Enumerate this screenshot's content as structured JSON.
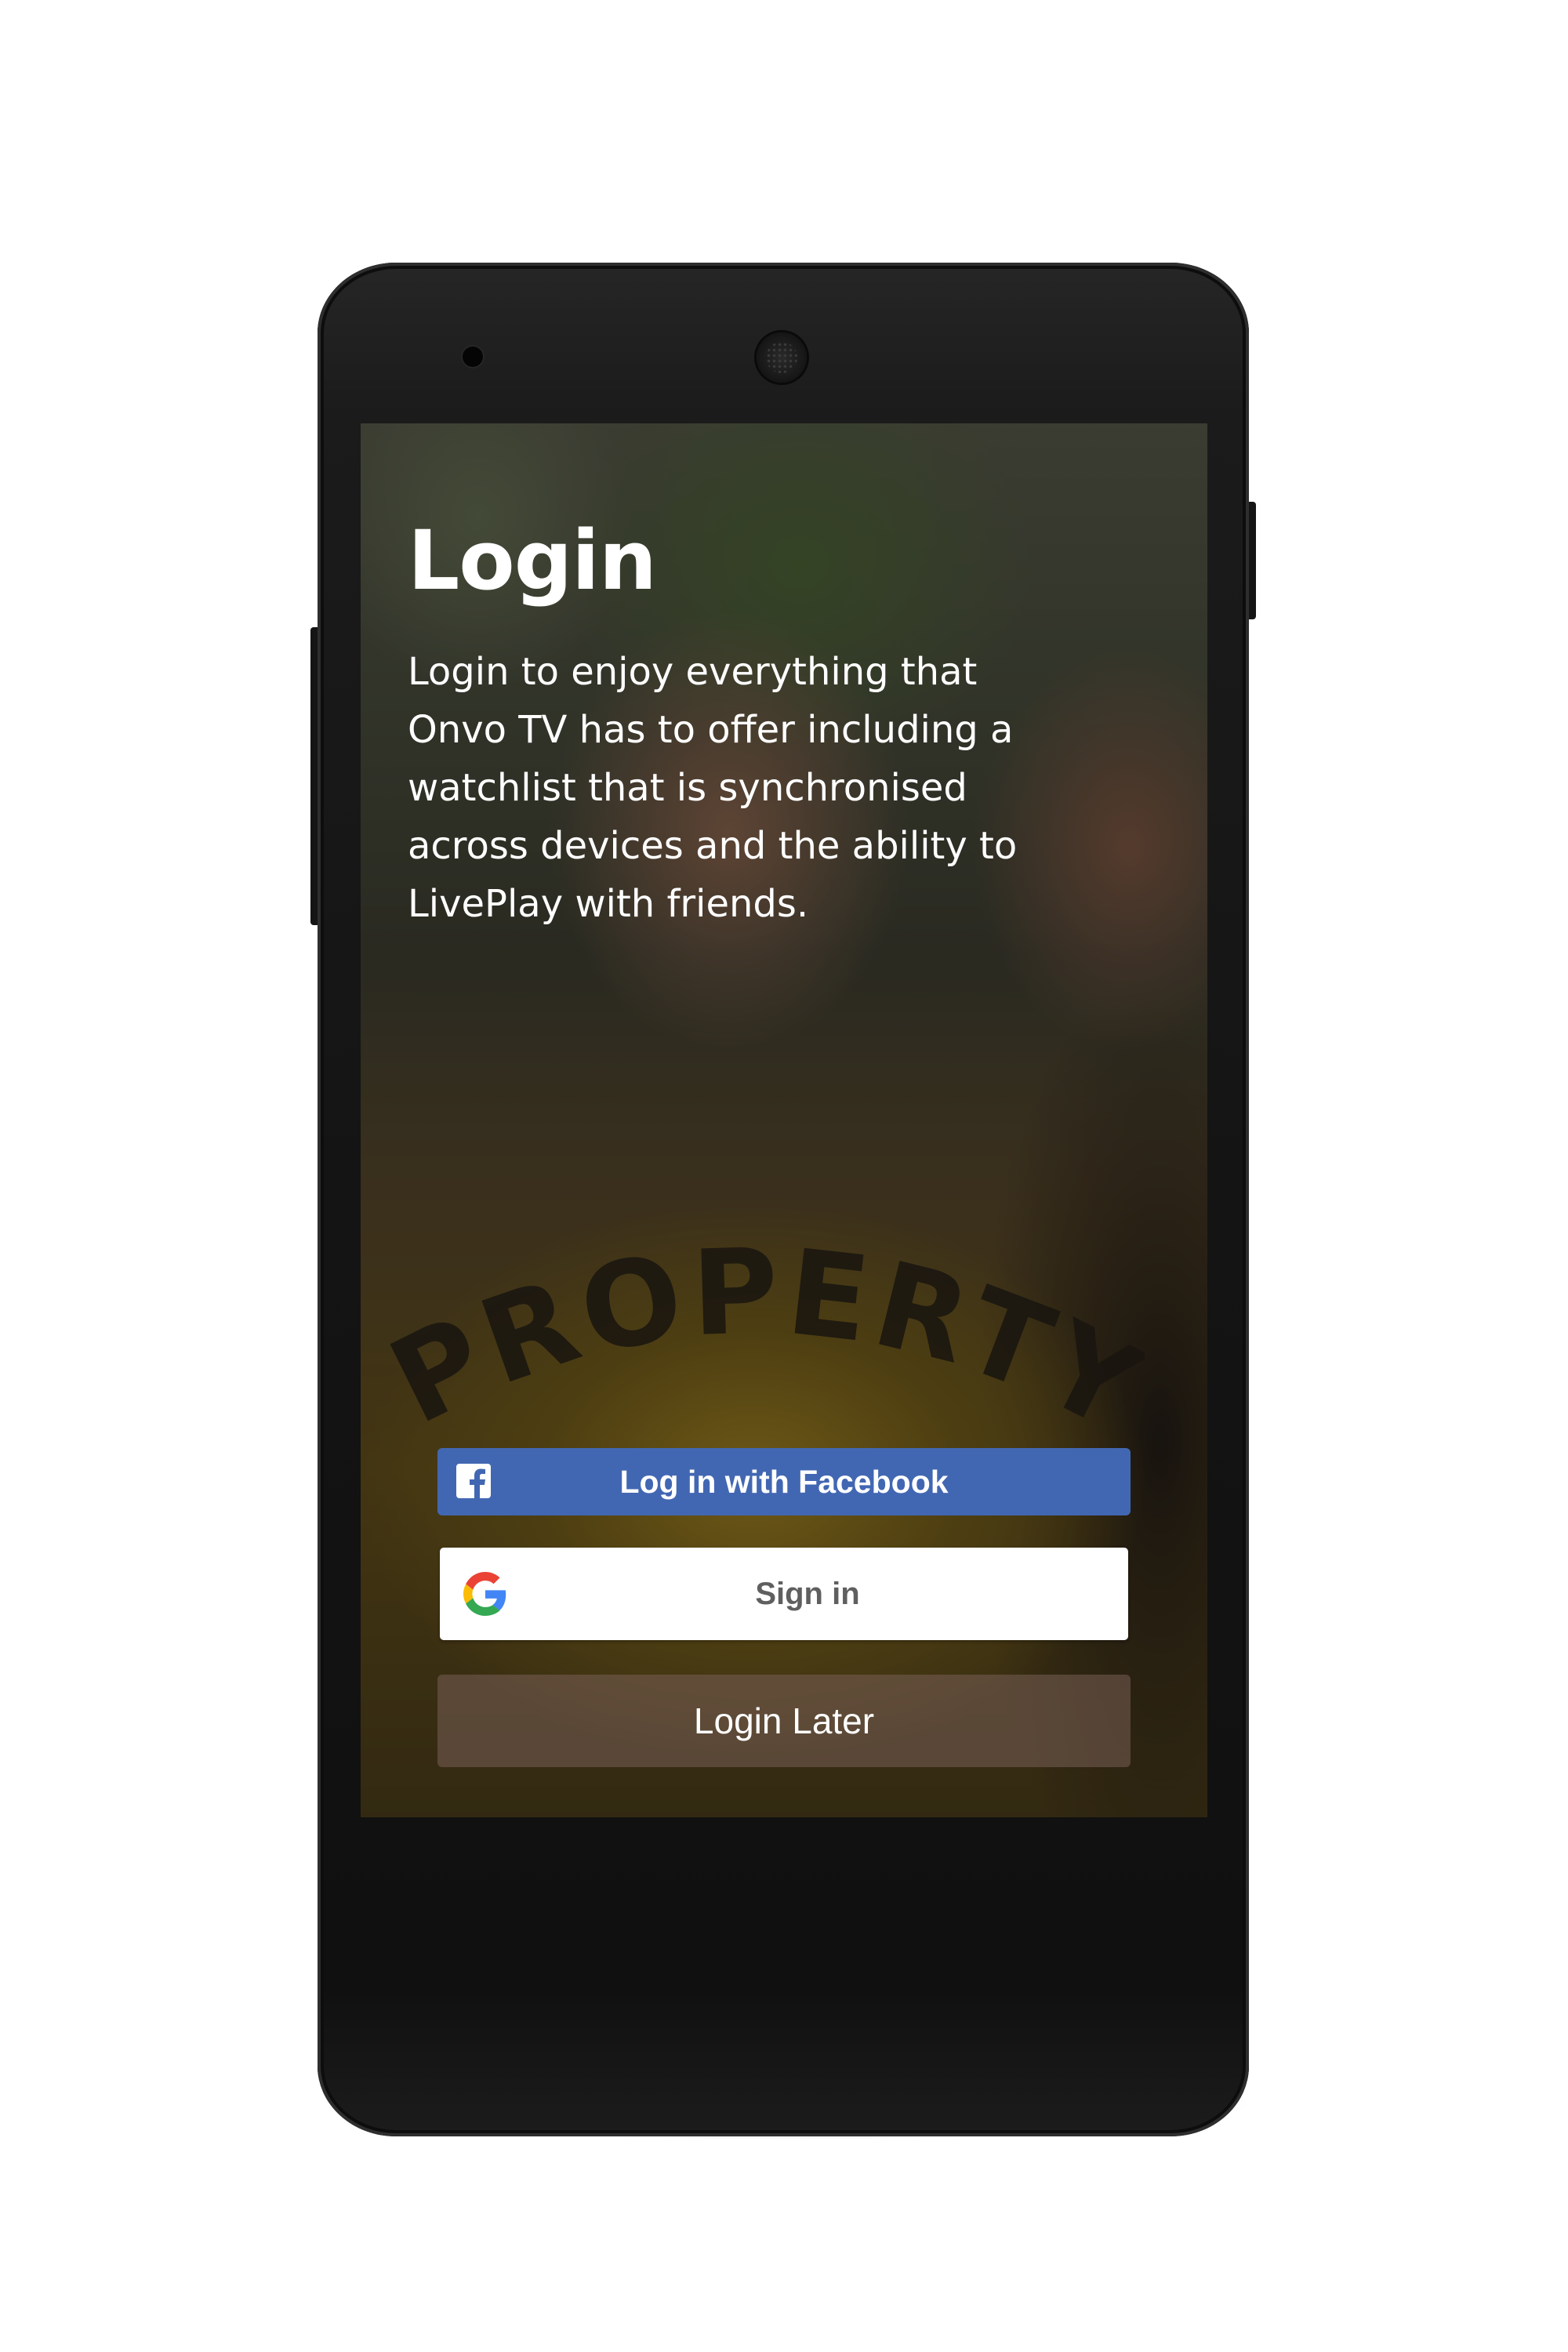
{
  "login_screen": {
    "title": "Login",
    "description": "Login to enjoy everything that Onvo TV has to offer including a watchlist that is synchronised across devices and the ability to LivePlay with friends.",
    "facebook_button_label": "Log in with Facebook",
    "google_button_label": "Sign in",
    "later_button_label": "Login Later"
  },
  "background_image": {
    "shirt_text": "PROPERTY OF"
  },
  "navbar": {
    "back_icon": "triangle-back-icon",
    "home_icon": "circle-home-icon",
    "recents_icon": "square-recents-icon"
  },
  "colors": {
    "facebook_blue": "#4267b2",
    "google_text": "#5f5f5f",
    "navbar": "#000000",
    "phone_body": "#141414"
  }
}
